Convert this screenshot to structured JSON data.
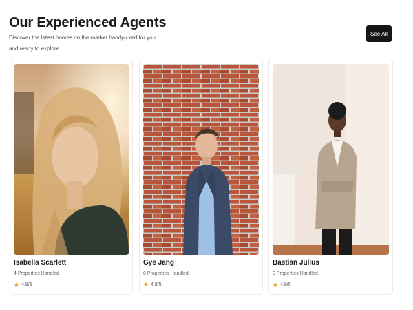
{
  "header": {
    "title": "Our Experienced Agents",
    "subtitle": "Discover the latest homes on the market handpicked for you and ready to explore.",
    "see_all_label": "See All"
  },
  "agents": [
    {
      "name": "Isabella Scarlett",
      "properties": "4 Properties Handled",
      "rating": "4.9/5",
      "photo_icon": "agent-photo"
    },
    {
      "name": "Gye Jang",
      "properties": "0 Properties Handled",
      "rating": "4.8/5",
      "photo_icon": "agent-photo"
    },
    {
      "name": "Bastian Julius",
      "properties": "0 Properties Handled",
      "rating": "4.9/5",
      "photo_icon": "agent-photo"
    }
  ],
  "icons": {
    "rating": "star-icon"
  },
  "colors": {
    "button_bg": "#161616",
    "star": "#e6a02d"
  }
}
